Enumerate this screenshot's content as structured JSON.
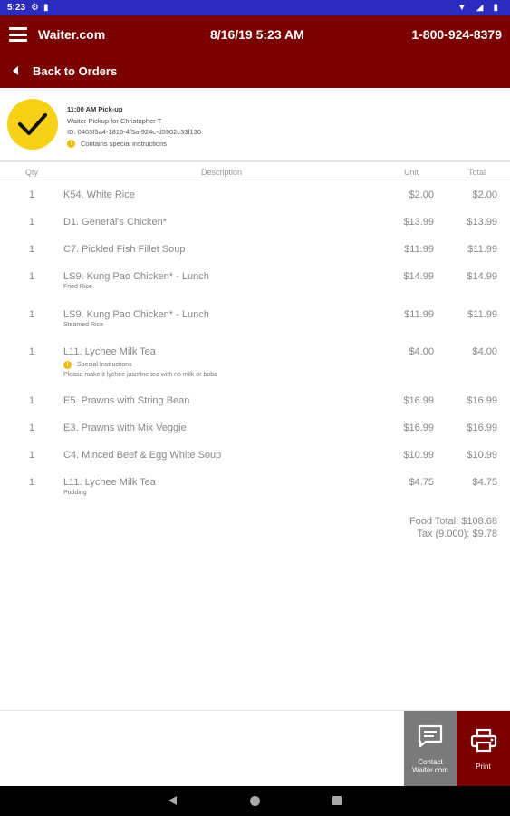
{
  "status_bar": {
    "time": "5:23",
    "icons": [
      "gear-icon",
      "sim-icon",
      "wifi-icon",
      "signal-icon",
      "battery-icon"
    ]
  },
  "header": {
    "brand": "Waiter.com",
    "datetime": "8/16/19 5:23 AM",
    "phone": "1-800-924-8379",
    "back_label": "Back to Orders",
    "color": "#7b0000"
  },
  "order": {
    "pickup_time": "11:00 AM Pick-up",
    "pickup_for": "Waiter Pickup for Christopher T",
    "id": "ID: 0403f5a4-1816-4f5a-924c-d5902c33f130",
    "special_note": "Contains special instructions",
    "status_color": "#f7d117"
  },
  "table": {
    "headers": {
      "qty": "Qty",
      "description": "Description",
      "unit": "Unit",
      "total": "Total"
    },
    "rows": [
      {
        "qty": "1",
        "desc": "K54. White Rice",
        "unit": "$2.00",
        "total": "$2.00"
      },
      {
        "qty": "1",
        "desc": "D1. General's Chicken*",
        "unit": "$13.99",
        "total": "$13.99"
      },
      {
        "qty": "1",
        "desc": "C7. Pickled Fish Fillet Soup",
        "unit": "$11.99",
        "total": "$11.99"
      },
      {
        "qty": "1",
        "desc": "LS9. Kung Pao Chicken* - Lunch",
        "sub": "Fried Rice",
        "unit": "$14.99",
        "total": "$14.99"
      },
      {
        "qty": "1",
        "desc": "LS9. Kung Pao Chicken* - Lunch",
        "sub": "Steamed Rice",
        "unit": "$11.99",
        "total": "$11.99"
      },
      {
        "qty": "1",
        "desc": "L11. Lychee Milk Tea",
        "special_label": "Special Instructions",
        "special_text": "Please make it lychee jasmine tea with no milk or boba",
        "unit": "$4.00",
        "total": "$4.00"
      },
      {
        "qty": "1",
        "desc": "E5. Prawns with String Bean",
        "unit": "$16.99",
        "total": "$16.99"
      },
      {
        "qty": "1",
        "desc": "E3. Prawns with Mix Veggie",
        "unit": "$16.99",
        "total": "$16.99"
      },
      {
        "qty": "1",
        "desc": "C4. Minced Beef & Egg White Soup",
        "unit": "$10.99",
        "total": "$10.99"
      },
      {
        "qty": "1",
        "desc": "L11. Lychee Milk Tea",
        "sub": "Pudding",
        "unit": "$4.75",
        "total": "$4.75"
      }
    ]
  },
  "totals": {
    "food_total": "Food Total: $108.68",
    "tax": "Tax (9.000): $9.78"
  },
  "actions": {
    "contact_line1": "Contact",
    "contact_line2": "Waiter.com",
    "print": "Print"
  }
}
